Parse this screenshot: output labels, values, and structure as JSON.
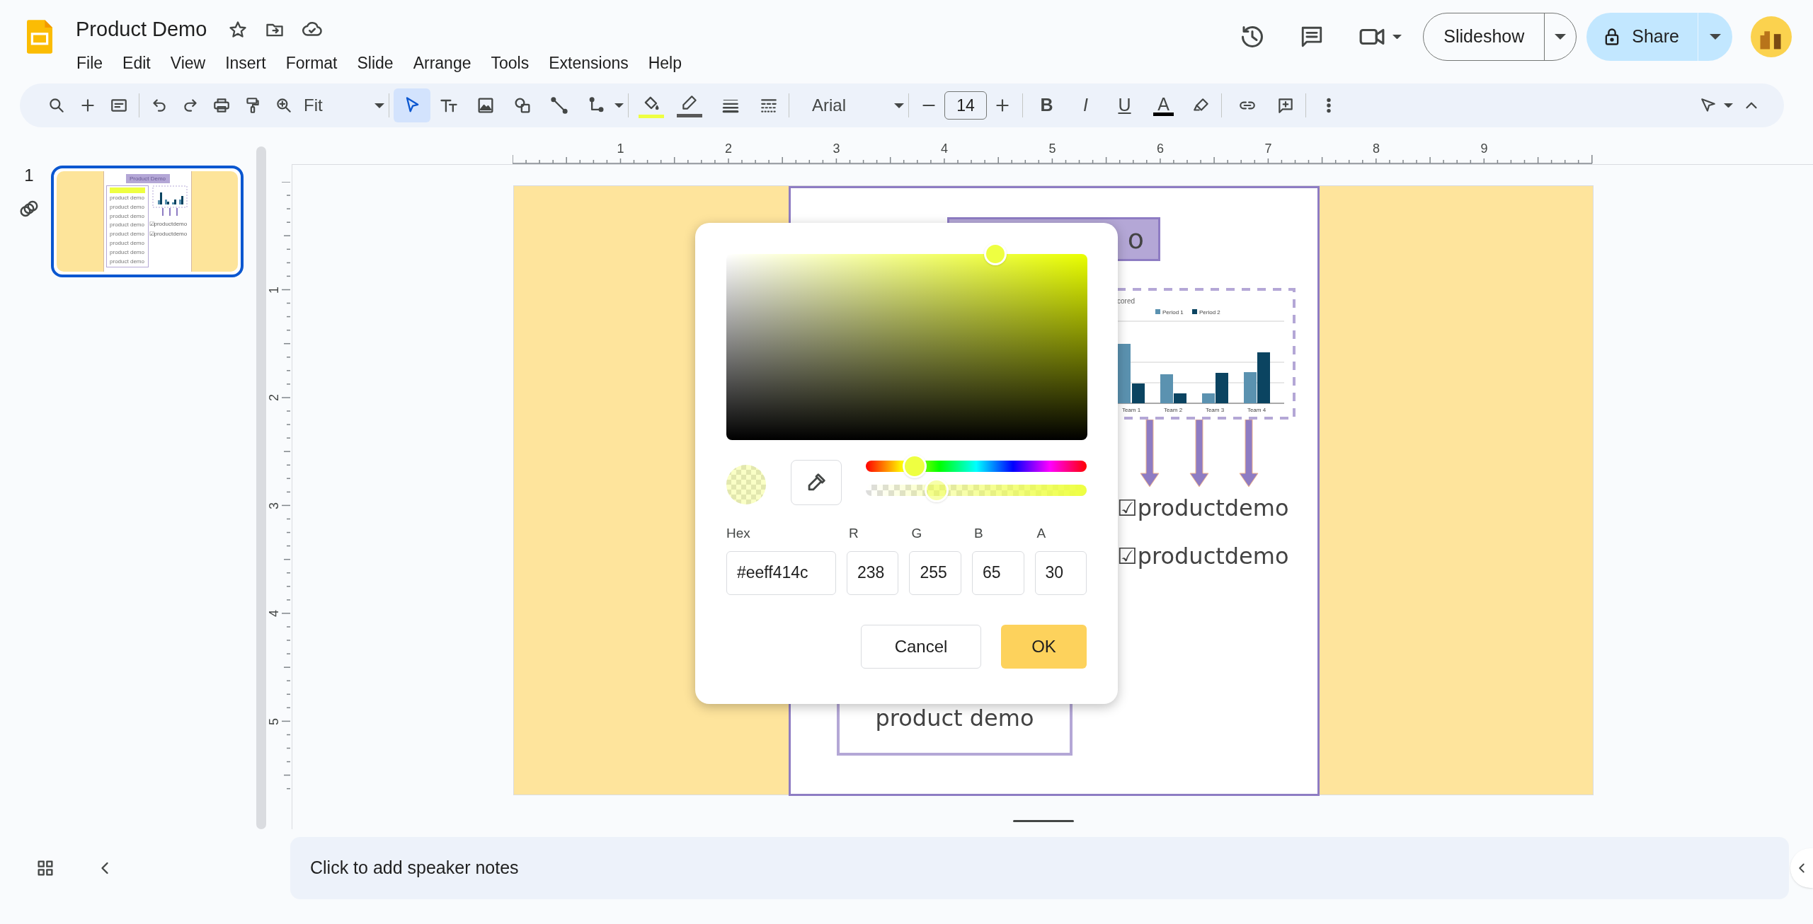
{
  "document": {
    "title": "Product Demo"
  },
  "menu": [
    "File",
    "Edit",
    "View",
    "Insert",
    "Format",
    "Slide",
    "Arrange",
    "Tools",
    "Extensions",
    "Help"
  ],
  "header": {
    "slideshow": "Slideshow",
    "share": "Share"
  },
  "toolbar": {
    "zoom": "Fit",
    "font": "Arial",
    "font_size": "14",
    "tools": [
      {
        "kind": "select",
        "selected": true
      },
      {
        "kind": "text",
        "selected": false
      },
      {
        "kind": "image",
        "selected": false
      },
      {
        "kind": "shape",
        "selected": false
      },
      {
        "kind": "line",
        "selected": false
      },
      {
        "kind": "connector",
        "selected": false
      }
    ],
    "format": [
      {
        "kind": "bold",
        "label": "B"
      },
      {
        "kind": "italic",
        "label": "I"
      },
      {
        "kind": "underline",
        "label": "U"
      },
      {
        "kind": "color",
        "label": "A"
      }
    ]
  },
  "slides": [
    {
      "number": "1",
      "selected": true,
      "linked": true,
      "thumbnail": {
        "title": "Product Demo",
        "list": [
          "product demo",
          "product demo",
          "product demo",
          "product demo",
          "product demo",
          "product demo",
          "product demo",
          "product demo"
        ],
        "checks": [
          "☑productdemo",
          "☑productdemo"
        ]
      }
    }
  ],
  "rulers": {
    "horizontal": [
      "1",
      "2",
      "3",
      "4",
      "5",
      "6",
      "7",
      "8",
      "9"
    ],
    "vertical": [
      "1",
      "2",
      "3",
      "4",
      "5"
    ]
  },
  "slide": {
    "title_visible": "o",
    "chart": {
      "title_visible": "cored",
      "legend": [
        "Period 1",
        "Period 2"
      ],
      "categories": [
        "Team 1",
        "Team 2",
        "Team 3",
        "Team 4"
      ]
    },
    "checks": [
      "☑productdemo",
      "☑productdemo"
    ],
    "box_text": "product demo"
  },
  "color_dialog": {
    "hex_label": "Hex",
    "hex": "#eeff414c",
    "channels": [
      {
        "label": "R",
        "value": "238"
      },
      {
        "label": "G",
        "value": "255"
      },
      {
        "label": "B",
        "value": "65"
      },
      {
        "label": "A",
        "value": "30"
      }
    ],
    "hue": {
      "level": 0.22
    },
    "alpha": {
      "level": 0.32
    },
    "cancel": "Cancel",
    "ok": "OK"
  },
  "speaker_notes": {
    "placeholder": "Click to add speaker notes"
  }
}
